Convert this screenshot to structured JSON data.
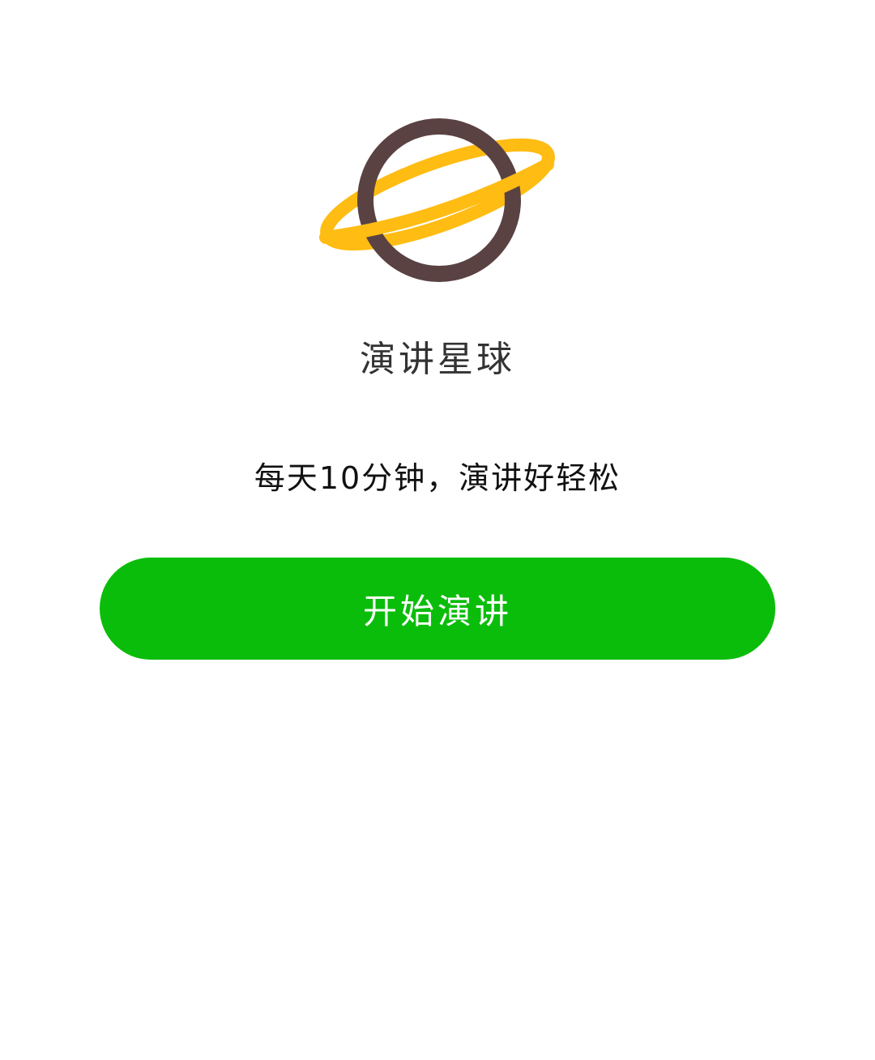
{
  "app": {
    "title": "演讲星球",
    "slogan": "每天10分钟，演讲好轻松"
  },
  "actions": {
    "start_label": "开始演讲"
  },
  "logo": {
    "icon": "planet-icon",
    "planet_color": "#5a4242",
    "ring_color": "#ffbc12"
  },
  "theme": {
    "accent": "#0bbd0b",
    "background": "#ffffff"
  }
}
